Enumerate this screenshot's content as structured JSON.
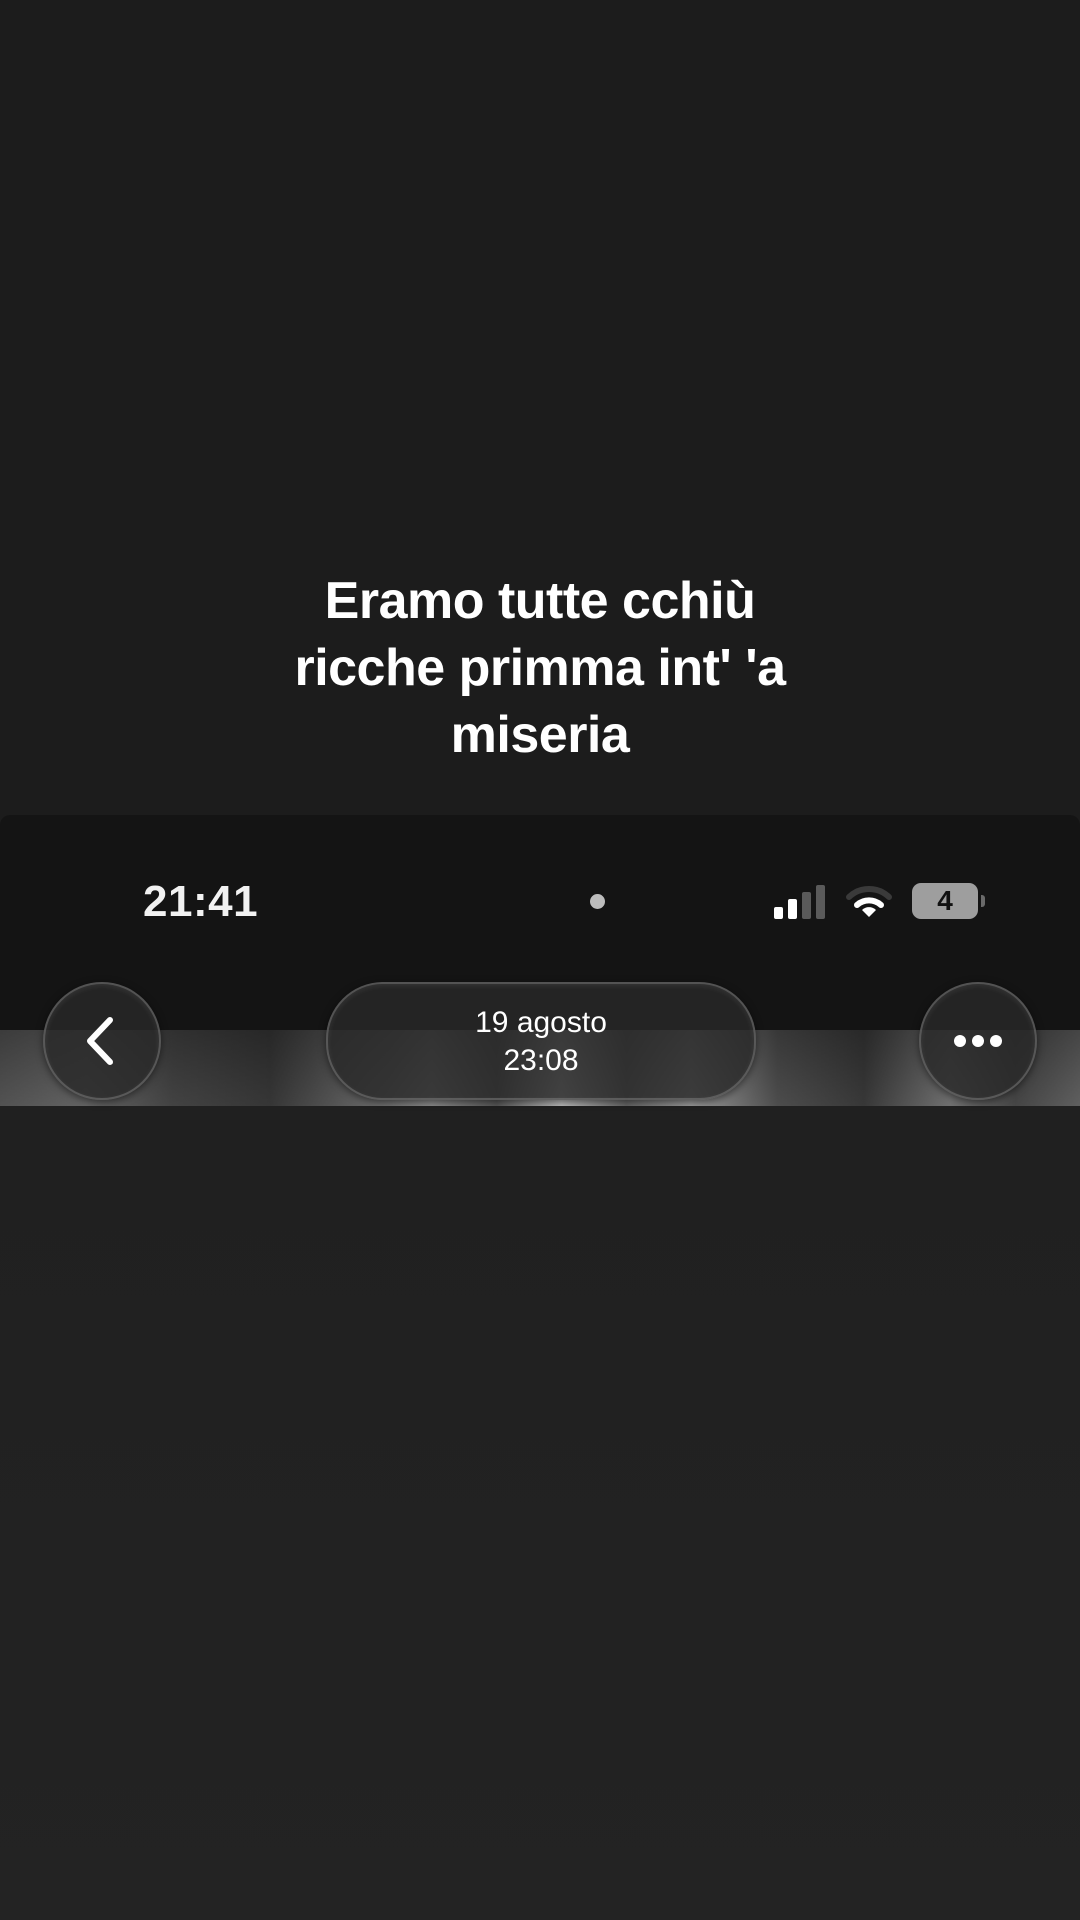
{
  "caption": {
    "lines": [
      "Eramo tutte cchiù",
      "ricche primma int' 'a",
      "miseria"
    ]
  },
  "status_bar": {
    "time": "21:41",
    "battery_level": "4",
    "signal_bars_active": 2,
    "signal_bars_total": 4
  },
  "header": {
    "back_icon": "chevron-left-icon",
    "date": "19 agosto",
    "time": "23:08",
    "more_icon": "ellipsis-icon"
  },
  "colors": {
    "background": "#1c1c1c",
    "text": "#ffffff",
    "status_bar": "#141414"
  }
}
